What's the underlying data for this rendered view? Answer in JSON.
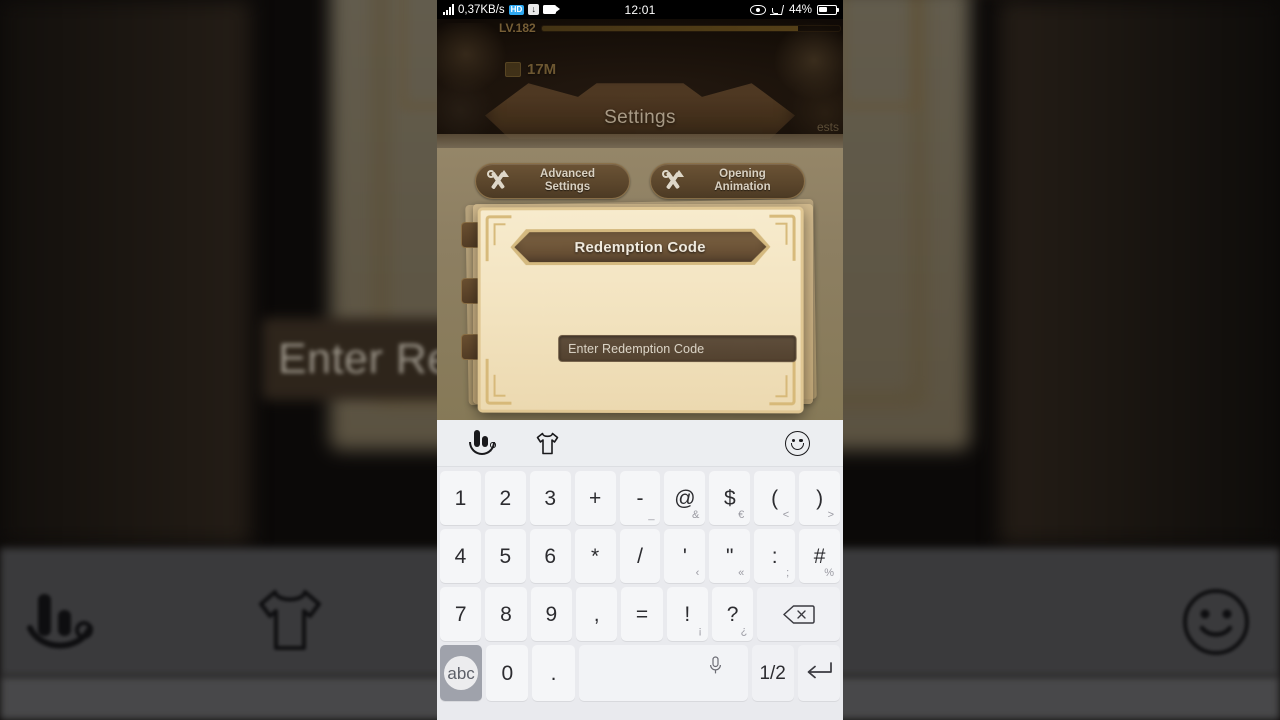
{
  "statusbar": {
    "network_speed": "0,37KB/s",
    "time": "12:01",
    "battery_percent": "44%",
    "icons": [
      "signal-icon",
      "hd-badge-icon",
      "download-icon",
      "screen-record-icon",
      "eye-icon",
      "cast-icon",
      "battery-icon"
    ]
  },
  "game": {
    "level": "LV.182",
    "currency": "17M",
    "header_title": "Settings",
    "header_right_word": "ests",
    "options": [
      {
        "label_line1": "Advanced",
        "label_line2": "Settings",
        "icon": "tools-icon"
      },
      {
        "label_line1": "Opening",
        "label_line2": "Animation",
        "icon": "tools-icon"
      }
    ]
  },
  "dialog": {
    "title": "Redemption Code",
    "input_placeholder": "Enter Redemption Code",
    "input_value": ""
  },
  "keyboard": {
    "toolbar": {
      "logo": "touchpal-logo-icon",
      "theme": "tshirt-icon",
      "emoji": "smiley-icon"
    },
    "rows": [
      [
        {
          "main": "1",
          "sub": ""
        },
        {
          "main": "2",
          "sub": ""
        },
        {
          "main": "3",
          "sub": ""
        },
        {
          "main": "+",
          "sub": ""
        },
        {
          "main": "-",
          "sub": "_"
        },
        {
          "main": "@",
          "sub": "&"
        },
        {
          "main": "$",
          "sub": "€"
        },
        {
          "main": "(",
          "sub": "<"
        },
        {
          "main": ")",
          "sub": ">"
        }
      ],
      [
        {
          "main": "4",
          "sub": ""
        },
        {
          "main": "5",
          "sub": ""
        },
        {
          "main": "6",
          "sub": ""
        },
        {
          "main": "*",
          "sub": ""
        },
        {
          "main": "/",
          "sub": ""
        },
        {
          "main": "'",
          "sub": "‹"
        },
        {
          "main": "\"",
          "sub": "«"
        },
        {
          "main": ":",
          "sub": ";"
        },
        {
          "main": "#",
          "sub": "%"
        }
      ],
      [
        {
          "main": "7",
          "sub": ""
        },
        {
          "main": "8",
          "sub": ""
        },
        {
          "main": "9",
          "sub": ""
        },
        {
          "main": ",",
          "sub": ""
        },
        {
          "main": "=",
          "sub": ""
        },
        {
          "main": "!",
          "sub": "¡"
        },
        {
          "main": "?",
          "sub": "¿"
        }
      ]
    ],
    "backspace": "backspace-icon",
    "bottom_row": {
      "abc_label": "abc",
      "zero": "0",
      "period": ".",
      "space_mic": "mic-icon",
      "page_label": "1/2",
      "enter": "enter-icon"
    }
  },
  "colors": {
    "keyboard_bg": "#e9eaee",
    "key_bg": "#f5f6f8",
    "key_pressed": "#9fa2ab",
    "dialog_bg": "#f3e4c1",
    "dialog_border": "#e0c793",
    "title_bar": "#6b5236",
    "settings_bg": "#8d7f62",
    "accent_badge": "#2fa8f0"
  }
}
